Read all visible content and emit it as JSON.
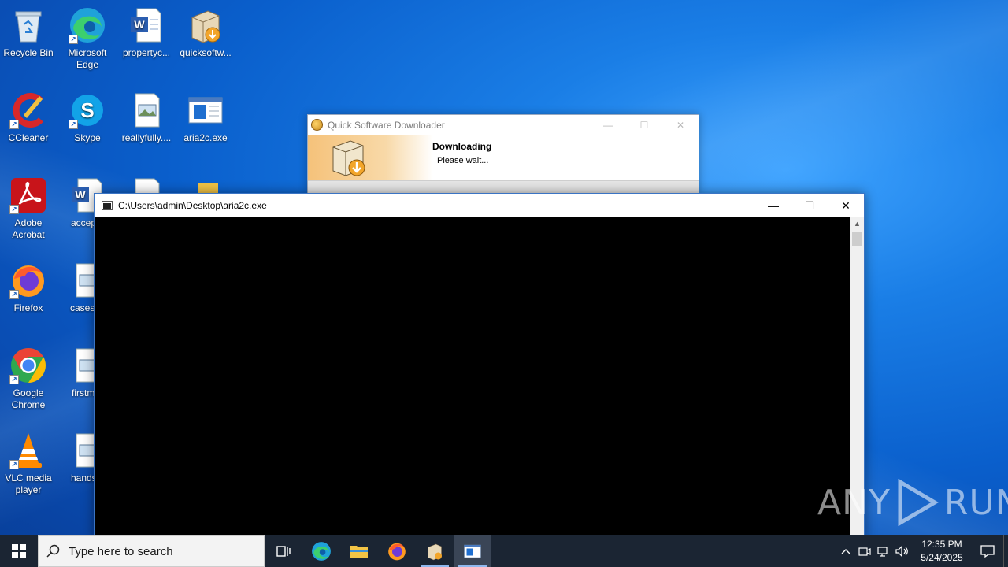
{
  "desktop": {
    "icons": [
      {
        "label": "Recycle Bin",
        "icon": "recycle-bin-icon"
      },
      {
        "label": "Microsoft Edge",
        "icon": "edge-icon"
      },
      {
        "label": "propertyc...",
        "icon": "word-doc-icon"
      },
      {
        "label": "quicksoftw...",
        "icon": "installer-icon"
      },
      {
        "label": "CCleaner",
        "icon": "ccleaner-icon"
      },
      {
        "label": "Skype",
        "icon": "skype-icon"
      },
      {
        "label": "reallyfully....",
        "icon": "image-file-icon"
      },
      {
        "label": "aria2c.exe",
        "icon": "exe-icon"
      },
      {
        "label": "Adobe Acrobat",
        "icon": "acrobat-icon"
      },
      {
        "label": "accepte",
        "icon": "word-doc-icon"
      },
      {
        "label": "Firefox",
        "icon": "firefox-icon"
      },
      {
        "label": "casesco",
        "icon": "image-file-icon"
      },
      {
        "label": "Google Chrome",
        "icon": "chrome-icon"
      },
      {
        "label": "firstmar",
        "icon": "image-file-icon"
      },
      {
        "label": "VLC media player",
        "icon": "vlc-icon"
      },
      {
        "label": "handsin",
        "icon": "image-file-icon"
      }
    ]
  },
  "downloader": {
    "title": "Quick Software Downloader",
    "heading": "Downloading",
    "status": "Please wait...",
    "min": "—",
    "max": "☐",
    "close": "✕"
  },
  "console": {
    "title": "C:\\Users\\admin\\Desktop\\aria2c.exe",
    "min": "—",
    "max": "☐",
    "close": "✕"
  },
  "watermark": {
    "left": "ANY",
    "right": "RUN"
  },
  "taskbar": {
    "search_placeholder": "Type here to search",
    "time": "12:35 PM",
    "date": "5/24/2025"
  },
  "colors": {
    "taskbar": "#1b2533",
    "desktop_accent": "#0a5fcc"
  }
}
